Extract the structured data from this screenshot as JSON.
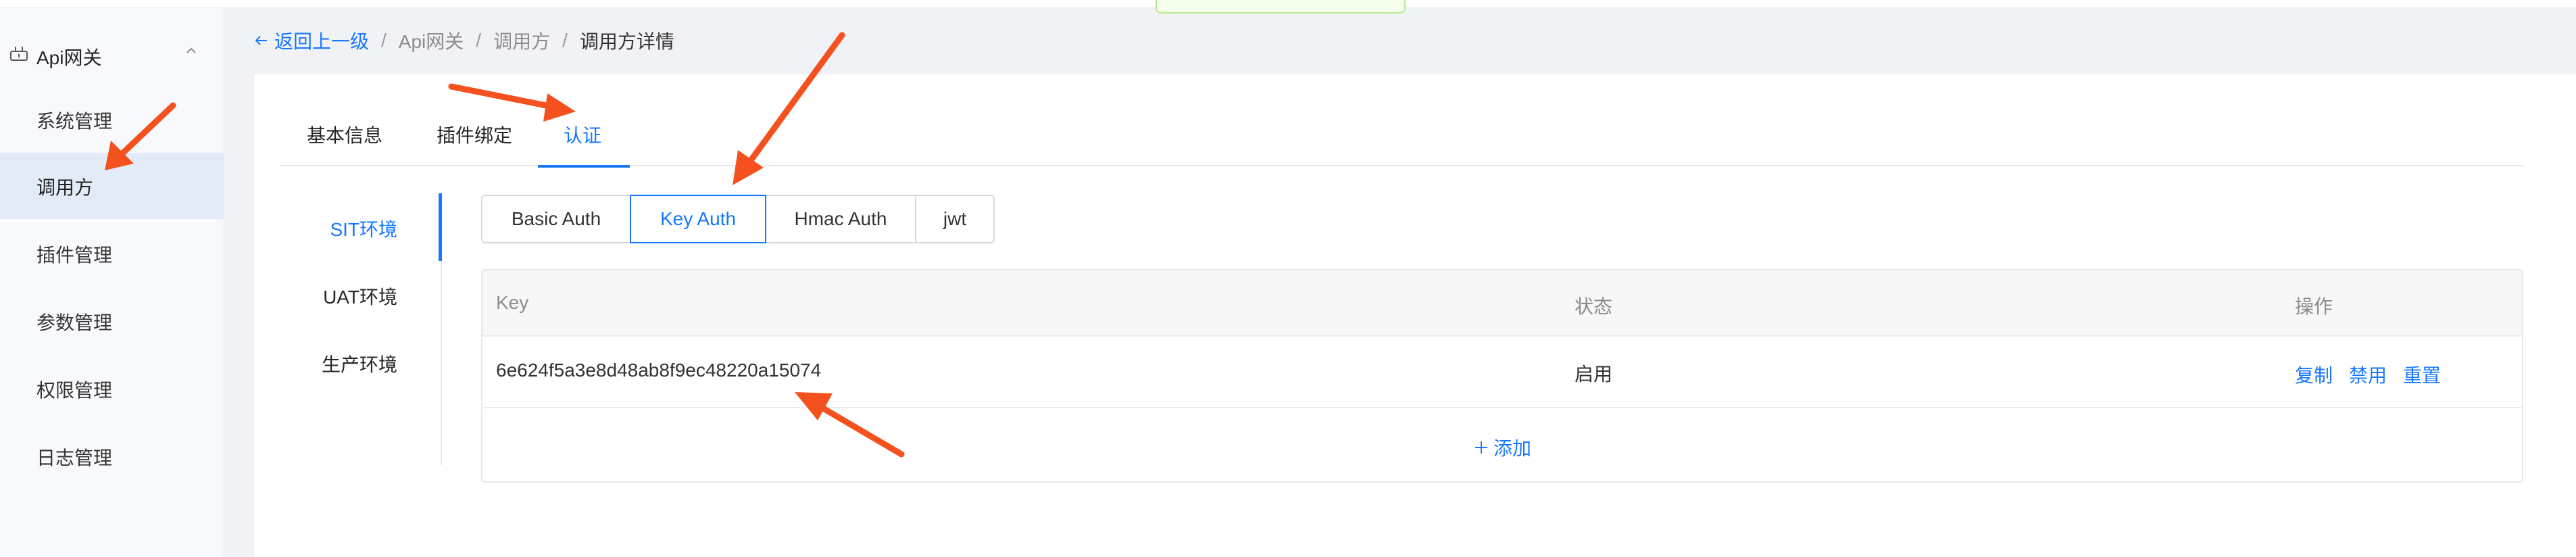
{
  "sidebar": {
    "group_title": "Api网关",
    "items": [
      {
        "label": "系统管理"
      },
      {
        "label": "调用方"
      },
      {
        "label": "插件管理"
      },
      {
        "label": "参数管理"
      },
      {
        "label": "权限管理"
      },
      {
        "label": "日志管理"
      }
    ]
  },
  "breadcrumb": {
    "back": "返回上一级",
    "items": [
      "Api网关",
      "调用方",
      "调用方详情"
    ]
  },
  "tabs": [
    "基本信息",
    "插件绑定",
    "认证"
  ],
  "environments": [
    "SIT环境",
    "UAT环境",
    "生产环境"
  ],
  "auth_types": [
    "Basic Auth",
    "Key Auth",
    "Hmac Auth",
    "jwt"
  ],
  "table": {
    "columns": [
      "Key",
      "状态",
      "操作"
    ],
    "rows": [
      {
        "key": "6e624f5a3e8d48ab8f9ec48220a15074",
        "status": "启用",
        "actions": [
          "复制",
          "禁用",
          "重置"
        ]
      }
    ],
    "add_label": "添加"
  },
  "colors": {
    "accent": "#1677ff",
    "arrow": "#f4511e",
    "sidebar_active": "#e4ebf8"
  }
}
